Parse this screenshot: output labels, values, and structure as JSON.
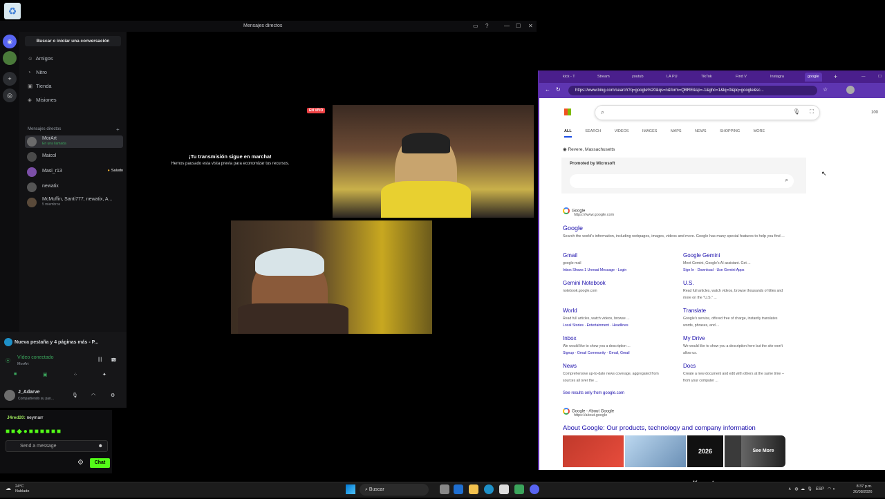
{
  "discord": {
    "window_title": "Mensajes directos",
    "search_label": "Buscar o iniciar una conversación",
    "nav": [
      {
        "label": "Amigos",
        "icon": "friends-icon"
      },
      {
        "label": "Nitro",
        "icon": "nitro-icon"
      },
      {
        "label": "Tienda",
        "icon": "shop-icon"
      },
      {
        "label": "Misiones",
        "icon": "quests-icon"
      }
    ],
    "dm_header": "Mensajes directos",
    "dms": [
      {
        "name": "MorArt",
        "sub": "En una llamada"
      },
      {
        "name": "Maicol",
        "sub": ""
      },
      {
        "name": "Masi_r13",
        "sub": "",
        "badge": "Saludo"
      },
      {
        "name": "newatix",
        "sub": ""
      },
      {
        "name": "McMuffin, Santi777, newatix, A...",
        "sub": "5 miembros"
      }
    ],
    "notification": "Nueva pestaña y 4 páginas más - P...",
    "voice_status": "Vídeo conectado",
    "voice_channel": "MorArt",
    "user_name": "J_Adarve",
    "user_status": "Compartiendo su pan...",
    "stream_heading": "¡Tu transmisión sigue en marcha!",
    "stream_sub": "Hemos pausado esta vista previa para economizar tus recursos.",
    "live_badge": "EN VIVO"
  },
  "chat": {
    "user": "J4red20:",
    "message": "neymarr",
    "placeholder": "Send a message",
    "send_label": "Chat"
  },
  "browser": {
    "tabs": [
      "kick - T",
      "Stream",
      "youtub",
      "LA PU",
      "TikTok",
      "Find V",
      "Instagra",
      "google"
    ],
    "url": "https://www.bing.com/search?q=google%20&qs=n&form=QBRE&sp=-1&ghc=1&lq=0&pq=google&sc...",
    "points": "100",
    "search_tabs": [
      "ALL",
      "SEARCH",
      "VIDEOS",
      "IMAGES",
      "MAPS",
      "NEWS",
      "SHOPPING",
      "MORE"
    ],
    "location": "Revere, Massachusetts",
    "promoted": "Promoted by Microsoft",
    "result": {
      "source": "Google",
      "url": "https://www.google.com",
      "title": "Google",
      "snippet": "Search the world's information, including webpages, images, videos and more. Google has many special features to help you find ..."
    },
    "sublinks": [
      {
        "title": "Gmail",
        "snip": "google mail",
        "links": "Inbox Shows 1 Unread Message · Login"
      },
      {
        "title": "Google Gemini",
        "snip": "Meet Gemini, Google's AI assistant. Get ...",
        "links": "Sign In · Download · Use Gemini Apps"
      },
      {
        "title": "Gemini Notebook",
        "snip": "notebook.google.com",
        "links": ""
      },
      {
        "title": "U.S.",
        "snip": "Read full articles, watch videos, browse thousands of titles and more on the \"U.S.\" ...",
        "links": ""
      },
      {
        "title": "World",
        "snip": "Read full articles, watch videos, browse ...",
        "links": "Local Stories · Entertainment · Headlines"
      },
      {
        "title": "Translate",
        "snip": "Google's service, offered free of charge, instantly translates words, phrases, and ...",
        "links": ""
      },
      {
        "title": "Inbox",
        "snip": "We would like to show you a description ...",
        "links": "Signup · Gmail Community · Gmail, Gmail"
      },
      {
        "title": "My Drive",
        "snip": "We would like to show you a description here but the site won't allow us.",
        "links": ""
      },
      {
        "title": "News",
        "snip": "Comprehensive up-to-date news coverage, aggregated from sources all over the ...",
        "links": ""
      },
      {
        "title": "Docs",
        "snip": "Create a new document and edit with others at the same time -- from your computer ...",
        "links": ""
      }
    ],
    "see_more_results": "See results only from google.com",
    "about_source": "Google - About Google",
    "about_url": "https://about.google",
    "about_title": "About Google: Our products, technology and company information",
    "keynote_label": "2026 Keynote",
    "see_more": "See More"
  },
  "taskbar": {
    "weather_temp": "24°C",
    "weather_text": "Nublado",
    "search": "Buscar",
    "lang": "ESP",
    "time": "8:37 p.m.",
    "date": "20/08/2026"
  }
}
